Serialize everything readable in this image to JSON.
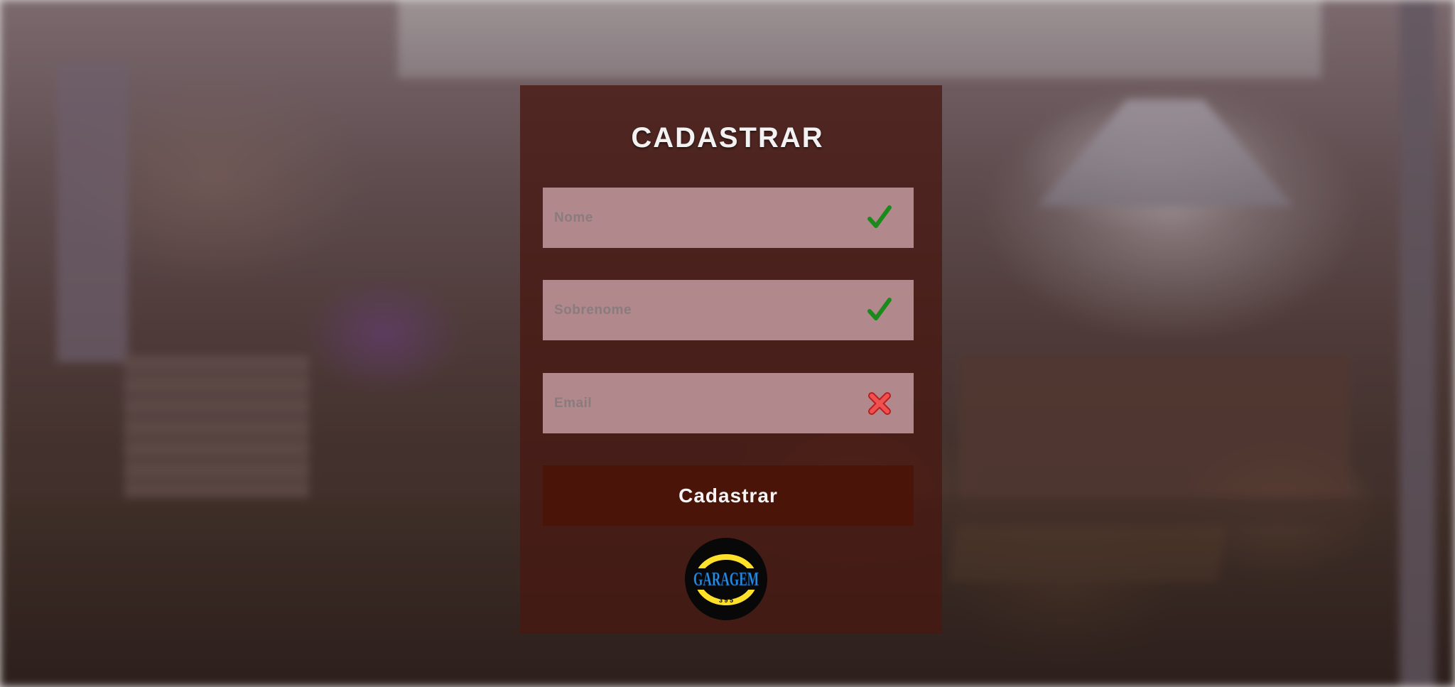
{
  "form": {
    "title": "CADASTRAR",
    "fields": [
      {
        "name": "nome",
        "placeholder": "Nome",
        "value": "",
        "status": "valid",
        "status_icon": "check-icon",
        "status_color": "#1a8a1a"
      },
      {
        "name": "sobrenome",
        "placeholder": "Sobrenome",
        "value": "",
        "status": "valid",
        "status_icon": "check-icon",
        "status_color": "#1a8a1a"
      },
      {
        "name": "email",
        "placeholder": "Email",
        "value": "",
        "status": "invalid",
        "status_icon": "x-icon",
        "status_color": "#e23a3a"
      }
    ],
    "submit_label": "Cadastrar"
  },
  "logo": {
    "text": "GARAGEM",
    "subtext": "3 9 5",
    "icon": "garagem-logo"
  },
  "colors": {
    "panel": "#48180f",
    "field_bg": "#c8a0a5",
    "button_bg": "#4a1409",
    "valid": "#1a8a1a",
    "invalid": "#e23a3a",
    "logo_yellow": "#ffe12a",
    "logo_blue": "#2a8fe0"
  }
}
